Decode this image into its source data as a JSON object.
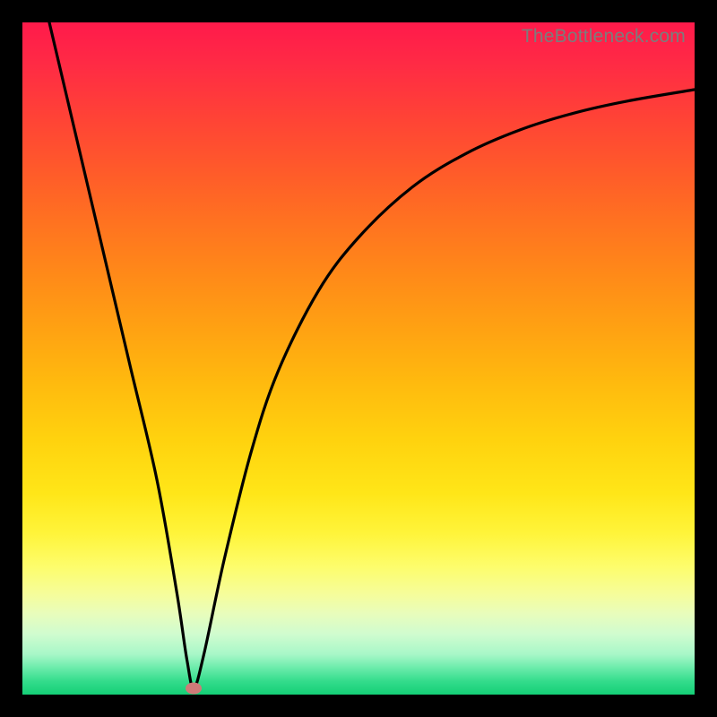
{
  "watermark": "TheBottleneck.com",
  "chart_data": {
    "type": "line",
    "title": "",
    "xlabel": "",
    "ylabel": "",
    "xlim": [
      0,
      100
    ],
    "ylim": [
      0,
      100
    ],
    "series": [
      {
        "name": "curve",
        "x": [
          4,
          8,
          12,
          16,
          20,
          23,
          24.5,
          25.5,
          27,
          30,
          34,
          38,
          44,
          50,
          58,
          66,
          74,
          82,
          90,
          100
        ],
        "y": [
          100,
          83,
          66,
          49,
          32,
          15,
          5,
          1,
          6,
          20,
          36,
          48,
          60,
          68,
          75.5,
          80.5,
          84,
          86.5,
          88.3,
          90
        ]
      }
    ],
    "marker": {
      "x": 25.5,
      "y": 1
    },
    "gradient_stops": [
      {
        "pct": 0,
        "color": "#ff1a4b"
      },
      {
        "pct": 50,
        "color": "#ffb010"
      },
      {
        "pct": 80,
        "color": "#fdfd6c"
      },
      {
        "pct": 100,
        "color": "#14cf76"
      }
    ]
  }
}
